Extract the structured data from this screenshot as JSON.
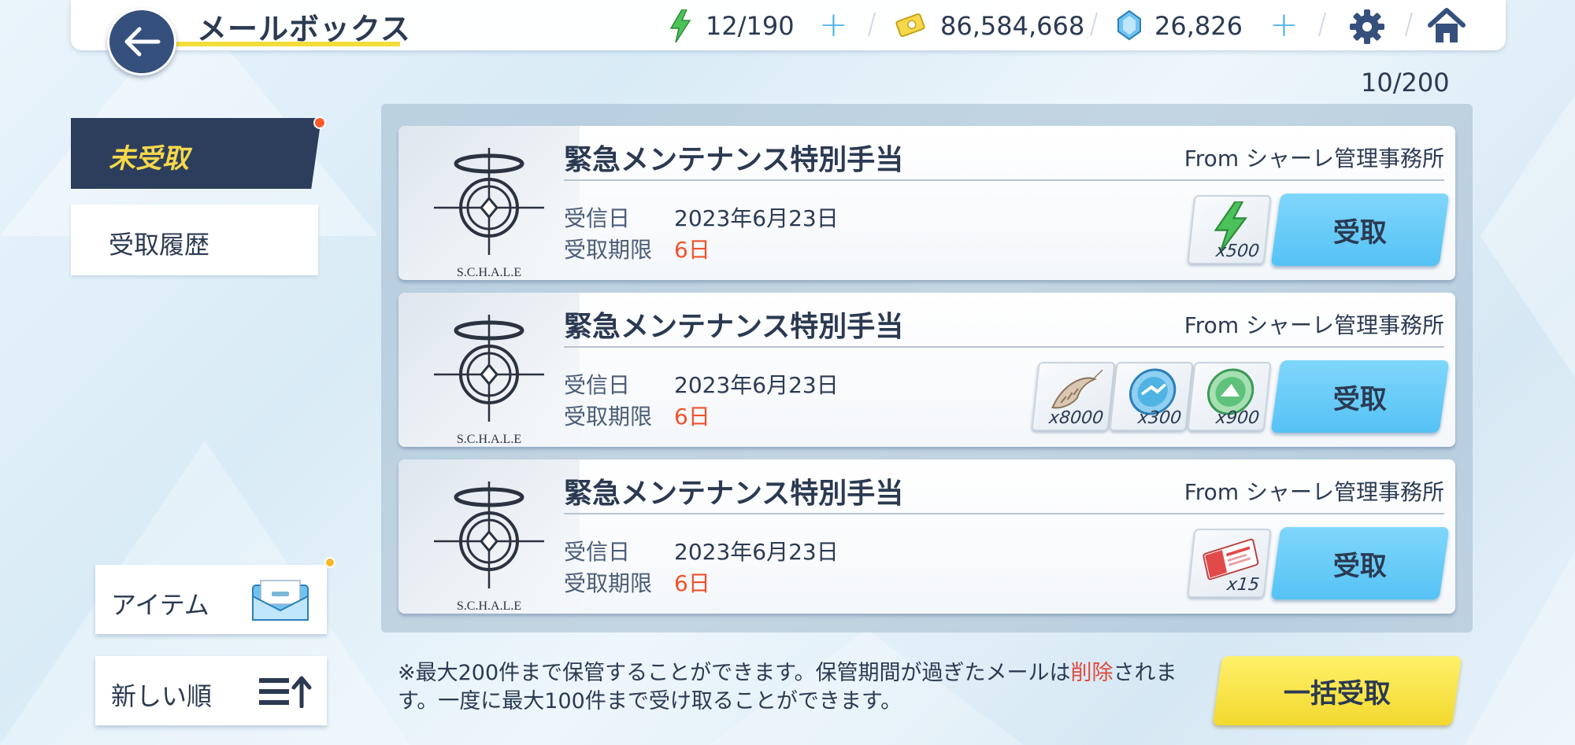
{
  "header": {
    "title": "メールボックス",
    "ap": "12/190",
    "credits": "86,584,668",
    "pyroxene": "26,826"
  },
  "mailbox": {
    "count": "10/200"
  },
  "sidebar": {
    "tabs": [
      {
        "label": "未受取"
      },
      {
        "label": "受取履歴"
      }
    ],
    "filter_item": "アイテム",
    "sort_order": "新しい順"
  },
  "mails": [
    {
      "title": "緊急メンテナンス特別手当",
      "from": "From シャーレ管理事務所",
      "logo_text": "S.C.H.A.L.E",
      "received_label": "受信日",
      "received_date": "2023年6月23日",
      "deadline_label": "受取期限",
      "deadline": "6日",
      "rewards": [
        {
          "icon": "ap-lightning-icon",
          "qty": "x500"
        }
      ],
      "button": "受取"
    },
    {
      "title": "緊急メンテナンス特別手当",
      "from": "From シャーレ管理事務所",
      "logo_text": "S.C.H.A.L.E",
      "received_label": "受信日",
      "received_date": "2023年6月23日",
      "deadline_label": "受取期限",
      "deadline": "6日",
      "rewards": [
        {
          "icon": "shrimp-item-icon",
          "qty": "x8000"
        },
        {
          "icon": "blue-coin-icon",
          "qty": "x300"
        },
        {
          "icon": "green-coin-icon",
          "qty": "x900"
        }
      ],
      "button": "受取"
    },
    {
      "title": "緊急メンテナンス特別手当",
      "from": "From シャーレ管理事務所",
      "logo_text": "S.C.H.A.L.E",
      "received_label": "受信日",
      "received_date": "2023年6月23日",
      "deadline_label": "受取期限",
      "deadline": "6日",
      "rewards": [
        {
          "icon": "ticket-icon",
          "qty": "x15"
        }
      ],
      "button": "受取"
    }
  ],
  "footer": {
    "note_part1": "※最大200件まで保管することができます。保管期間が過ぎたメールは",
    "note_red": "削除",
    "note_part2": "されます。一度に最大100件まで受け取ることができます。",
    "bulk_button": "一括受取"
  },
  "colors": {
    "accent_blue": "#55c2f4",
    "accent_yellow": "#f2d92e",
    "navy": "#2c3e5c",
    "alert_red": "#f0522c"
  }
}
